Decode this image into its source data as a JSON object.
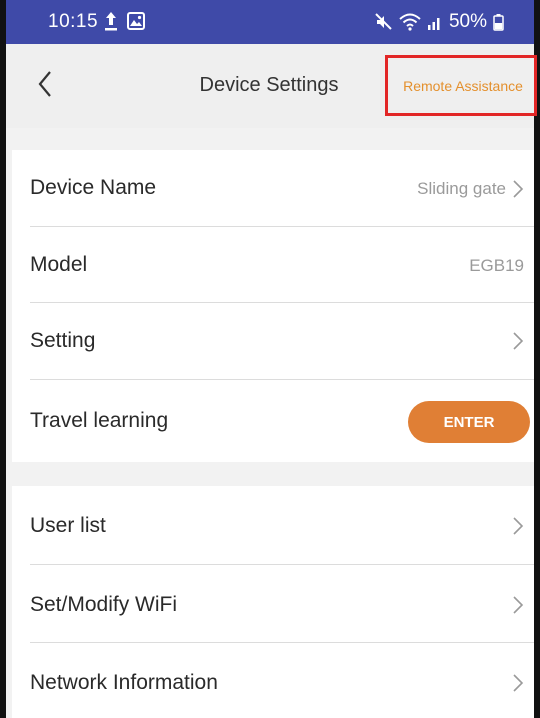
{
  "status_bar": {
    "time": "10:15",
    "battery": "50%",
    "icons": [
      "upload-icon",
      "photo-icon",
      "mute-icon",
      "wifi-icon",
      "signal-icon",
      "battery-icon"
    ]
  },
  "header": {
    "title": "Device Settings",
    "remote_assistance_label": "Remote Assistance",
    "back_icon": "chevron-left-icon"
  },
  "device_section": {
    "device_name_label": "Device Name",
    "device_name_value": "Sliding gate",
    "model_label": "Model",
    "model_value": "EGB19",
    "setting_label": "Setting",
    "travel_learning_label": "Travel learning",
    "enter_label": "ENTER"
  },
  "network_section": {
    "user_list_label": "User list",
    "wifi_label": "Set/Modify WiFi",
    "network_info_label": "Network Information"
  },
  "colors": {
    "status_bar": "#3f4aa8",
    "accent_orange": "#e07f35",
    "highlight_red": "#e22626"
  }
}
